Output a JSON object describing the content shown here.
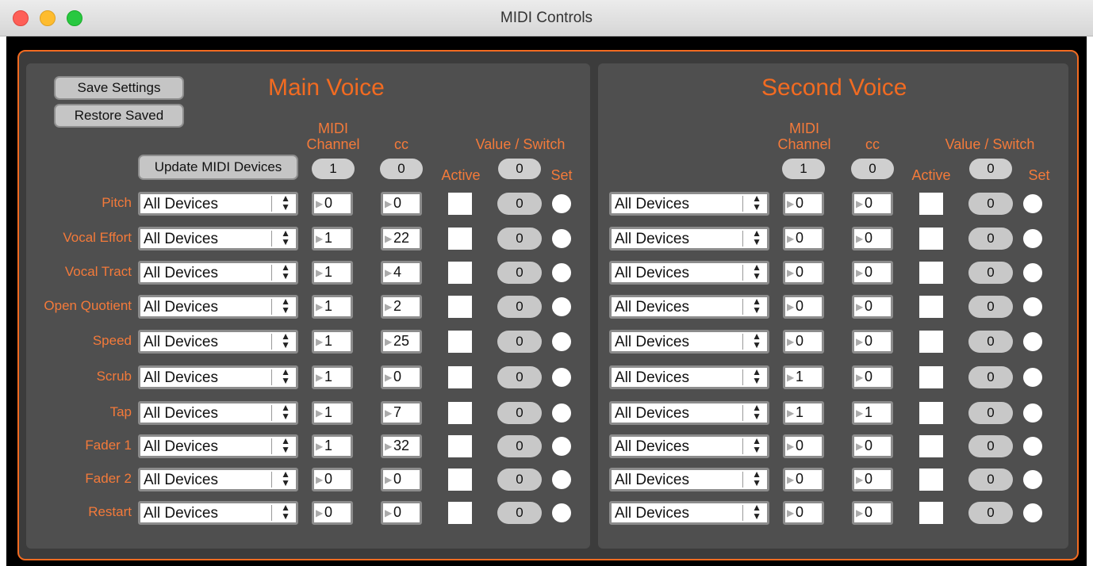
{
  "window": {
    "title": "MIDI Controls"
  },
  "buttons": {
    "save": "Save Settings",
    "restore": "Restore Saved",
    "update": "Update MIDI Devices"
  },
  "headers": {
    "midi": "MIDI",
    "channel": "Channel",
    "cc": "cc",
    "value_switch": "Value / Switch",
    "active": "Active",
    "set": "Set"
  },
  "main": {
    "title": "Main Voice",
    "channel": "1",
    "cc": "0",
    "value": "0",
    "rows": [
      {
        "label": "Pitch",
        "device": "All Devices",
        "channel": "0",
        "cc": "0",
        "value": "0"
      },
      {
        "label": "Vocal Effort",
        "device": "All Devices",
        "channel": "1",
        "cc": "22",
        "value": "0"
      },
      {
        "label": "Vocal Tract",
        "device": "All Devices",
        "channel": "1",
        "cc": "4",
        "value": "0"
      },
      {
        "label": "Open Quotient",
        "device": "All Devices",
        "channel": "1",
        "cc": "2",
        "value": "0"
      },
      {
        "label": "Speed",
        "device": "All Devices",
        "channel": "1",
        "cc": "25",
        "value": "0"
      },
      {
        "label": "Scrub",
        "device": "All Devices",
        "channel": "1",
        "cc": "0",
        "value": "0"
      },
      {
        "label": "Tap",
        "device": "All Devices",
        "channel": "1",
        "cc": "7",
        "value": "0"
      },
      {
        "label": "Fader 1",
        "device": "All Devices",
        "channel": "1",
        "cc": "32",
        "value": "0"
      },
      {
        "label": "Fader 2",
        "device": "All Devices",
        "channel": "0",
        "cc": "0",
        "value": "0"
      },
      {
        "label": "Restart",
        "device": "All Devices",
        "channel": "0",
        "cc": "0",
        "value": "0"
      }
    ]
  },
  "second": {
    "title": "Second Voice",
    "channel": "1",
    "cc": "0",
    "value": "0",
    "rows": [
      {
        "device": "All Devices",
        "channel": "0",
        "cc": "0",
        "value": "0"
      },
      {
        "device": "All Devices",
        "channel": "0",
        "cc": "0",
        "value": "0"
      },
      {
        "device": "All Devices",
        "channel": "0",
        "cc": "0",
        "value": "0"
      },
      {
        "device": "All Devices",
        "channel": "0",
        "cc": "0",
        "value": "0"
      },
      {
        "device": "All Devices",
        "channel": "0",
        "cc": "0",
        "value": "0"
      },
      {
        "device": "All Devices",
        "channel": "1",
        "cc": "0",
        "value": "0"
      },
      {
        "device": "All Devices",
        "channel": "1",
        "cc": "1",
        "value": "0"
      },
      {
        "device": "All Devices",
        "channel": "0",
        "cc": "0",
        "value": "0"
      },
      {
        "device": "All Devices",
        "channel": "0",
        "cc": "0",
        "value": "0"
      },
      {
        "device": "All Devices",
        "channel": "0",
        "cc": "0",
        "value": "0"
      }
    ]
  },
  "colors": {
    "accent": "#f26b21",
    "label": "#f47a3a",
    "panel": "#4f4f4f"
  }
}
